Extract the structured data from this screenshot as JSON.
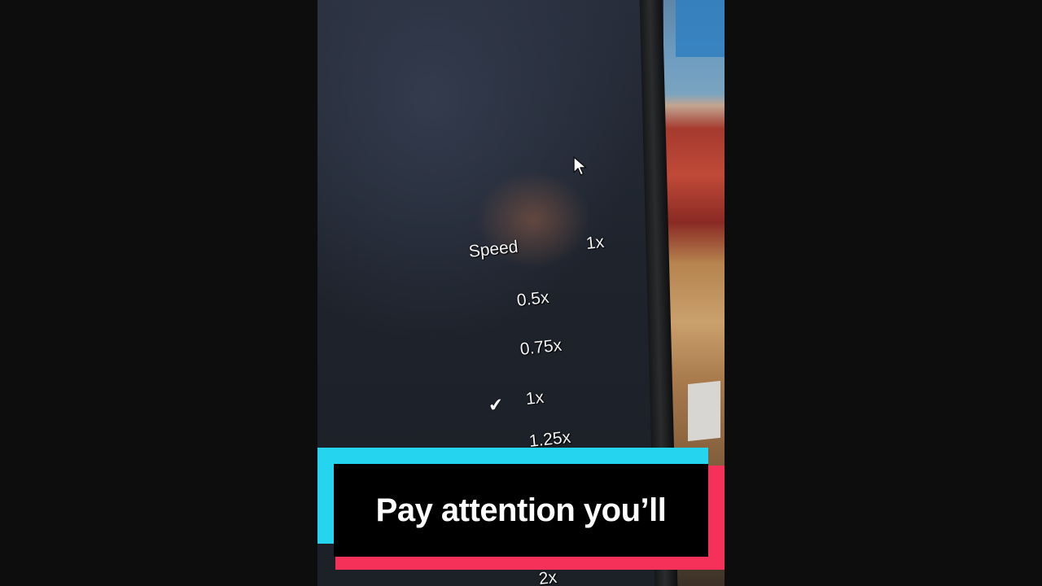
{
  "player_menu": {
    "header_label": "Speed",
    "current_value": "1x",
    "options": [
      {
        "label": "0.5x",
        "selected": false
      },
      {
        "label": "0.75x",
        "selected": false
      },
      {
        "label": "1x",
        "selected": true
      },
      {
        "label": "1.25x",
        "selected": false
      },
      {
        "label": "2x",
        "selected": false
      }
    ],
    "check_glyph": "✔"
  },
  "caption": {
    "text": "Pay attention you’ll",
    "accent_cyan": "#25d5ef",
    "accent_pink": "#f5315a"
  },
  "icons": [
    "mouse-cursor-icon",
    "checkmark-icon"
  ]
}
